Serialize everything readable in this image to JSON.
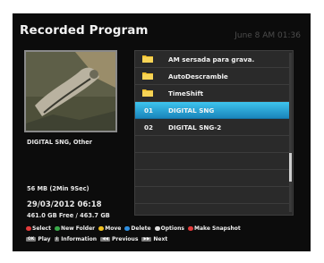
{
  "header": {
    "title": "Recorded Program",
    "clock": "June 8 AM 01:36"
  },
  "details": {
    "program_name": "DIGITAL SNG, Other",
    "size_duration": "56 MB (2Min 9Sec)",
    "date_time": "29/03/2012 06:18",
    "storage": "461.0 GB Free / 463.7 GB"
  },
  "list": {
    "items": [
      {
        "type": "folder",
        "num": "",
        "label": "AM sersada para grava."
      },
      {
        "type": "folder",
        "num": "",
        "label": "AutoDescramble"
      },
      {
        "type": "folder",
        "num": "",
        "label": "TimeShift"
      },
      {
        "type": "recording",
        "num": "01",
        "label": "DIGITAL SNG",
        "selected": true
      },
      {
        "type": "recording",
        "num": "02",
        "label": "DIGITAL SNG-2"
      }
    ],
    "scroll_position": 0.63
  },
  "helpbar": {
    "row1": [
      {
        "color": "#e23b3b",
        "label": "Select"
      },
      {
        "color": "#3aa94a",
        "label": "New Folder"
      },
      {
        "color": "#f0c020",
        "label": "Move"
      },
      {
        "color": "#2f8fe0",
        "label": "Delete"
      },
      {
        "color": "#e0e0e0",
        "label": "Options"
      },
      {
        "color": "#e23b3b",
        "label": "Make Snapshot"
      }
    ],
    "row2": [
      {
        "key": "OK",
        "label": "Play"
      },
      {
        "key": "i",
        "label": "Information"
      },
      {
        "key": "◀◀",
        "label": "Previous"
      },
      {
        "key": "▶▶",
        "label": "Next"
      }
    ]
  },
  "colors": {
    "selection": "#2aa6d8",
    "folder": "#f2c12e"
  }
}
